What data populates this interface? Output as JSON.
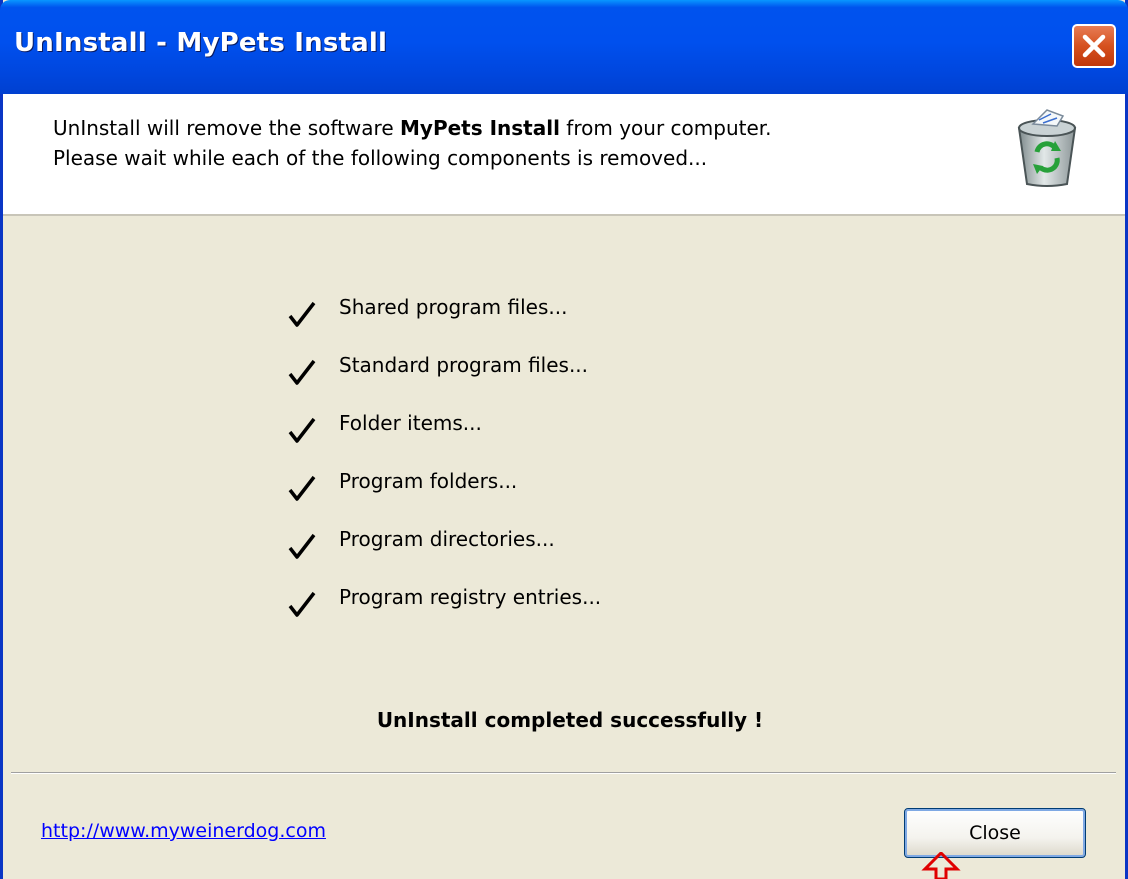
{
  "window": {
    "title": "UnInstall - MyPets Install"
  },
  "header": {
    "line1_prefix": "UnInstall will remove the software ",
    "line1_product": "MyPets Install",
    "line1_suffix": " from your computer.",
    "line2": "Please wait while each of the following components is removed..."
  },
  "steps": [
    {
      "label": "Shared program files...",
      "done": true
    },
    {
      "label": "Standard program files...",
      "done": true
    },
    {
      "label": "Folder items...",
      "done": true
    },
    {
      "label": "Program folders...",
      "done": true
    },
    {
      "label": "Program directories...",
      "done": true
    },
    {
      "label": "Program registry entries...",
      "done": true
    }
  ],
  "status_text": "UnInstall completed successfully !",
  "footer": {
    "link_text": "http://www.myweinerdog.com",
    "close_label": "Close"
  },
  "icons": {
    "title_close": "close-x-icon",
    "header": "recycle-bin-icon",
    "step": "checkmark-icon",
    "pointer": "mouse-pointer-icon"
  },
  "colors": {
    "titlebar": "#0053EE",
    "window_bg": "#ECE9D8",
    "link": "#0000FF",
    "close_x": "#D6511F",
    "pointer": "#E00000"
  }
}
